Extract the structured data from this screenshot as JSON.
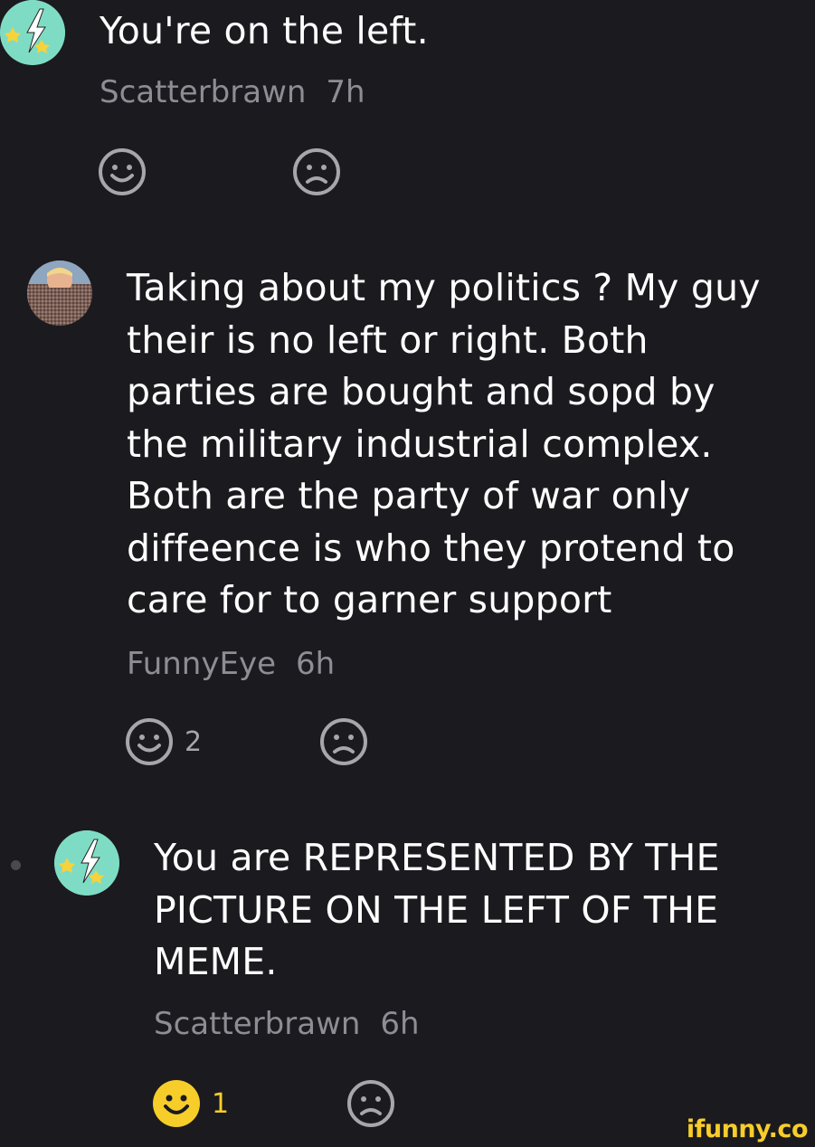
{
  "comments": [
    {
      "text": "You're on the left.",
      "author": "Scatterbrawn",
      "time": "7h",
      "avatar_icon": "lightning-stars-avatar",
      "likes": "",
      "liked": false
    },
    {
      "text": "Taking about my politics ? My guy\ntheir is no left or right. Both\nparties are bought and sopd by\nthe military industrial complex.\nBoth are the party of war only\ndiffeence is who they protend to\ncare for to garner support",
      "author": "FunnyEye",
      "time": "6h",
      "avatar_icon": "photo-avatar",
      "likes": "2",
      "liked": false
    },
    {
      "text": "You are REPRESENTED BY THE\nPICTURE ON THE LEFT OF THE\nMEME.",
      "author": "Scatterbrawn",
      "time": "6h",
      "avatar_icon": "lightning-stars-avatar",
      "likes": "1",
      "liked": true
    }
  ],
  "icons": {
    "smile": "smile-icon",
    "frown": "frown-icon"
  },
  "watermark": "ifunny.co",
  "colors": {
    "background": "#1b1a1f",
    "text": "#ffffff",
    "meta": "#8e8d93",
    "icon": "#a7a6ab",
    "liked": "#f7cd2a",
    "avatar_teal": "#7fdcc4"
  }
}
